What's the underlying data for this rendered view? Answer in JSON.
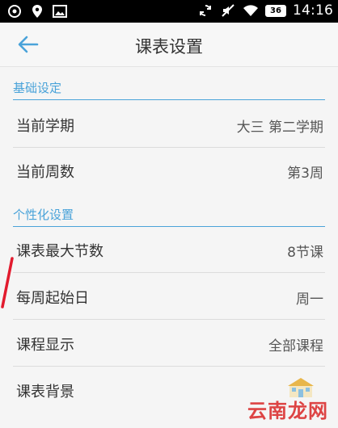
{
  "status_bar": {
    "time": "14:16",
    "battery": "36",
    "left_icons": [
      "notification-icon",
      "location-icon",
      "image-icon"
    ],
    "right_icons": [
      "sync-icon",
      "mute-icon",
      "wifi-icon",
      "battery-icon"
    ]
  },
  "app_bar": {
    "title": "课表设置",
    "back_icon": "back-arrow-icon"
  },
  "sections": {
    "basic": {
      "header": "基础设定",
      "rows": [
        {
          "label": "当前学期",
          "value": "大三  第二学期"
        },
        {
          "label": "当前周数",
          "value": "第3周"
        }
      ]
    },
    "personal": {
      "header": "个性化设置",
      "rows": [
        {
          "label": "课表最大节数",
          "value": "8节课"
        },
        {
          "label": "每周起始日",
          "value": "周一"
        },
        {
          "label": "课程显示",
          "value": "全部课程"
        },
        {
          "label": "课表背景",
          "value": ""
        }
      ]
    }
  },
  "watermark": "云南龙网",
  "colors": {
    "accent": "#4aa3d9",
    "status_bar_bg": "#000000",
    "background": "#f5f5f5"
  }
}
